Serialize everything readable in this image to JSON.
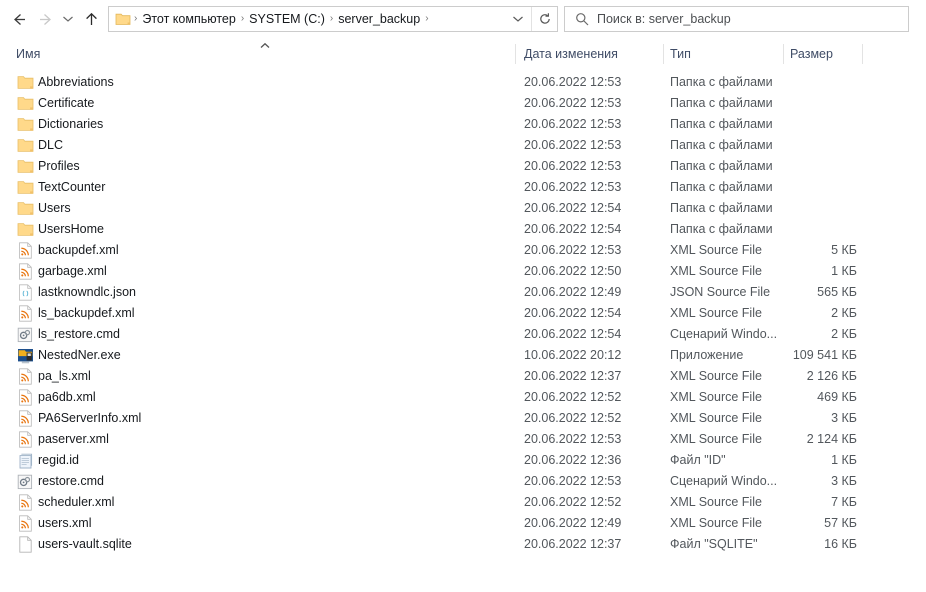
{
  "nav": {
    "back": "back-arrow",
    "forward": "forward-arrow",
    "recent": "recent-locations-chevron",
    "up": "up-arrow"
  },
  "address": {
    "crumbs": [
      "Этот компьютер",
      "SYSTEM (C:)",
      "server_backup"
    ],
    "separator": "›",
    "dropdown_icon": "chevron-down-icon",
    "refresh_icon": "refresh-icon"
  },
  "search": {
    "placeholder": "Поиск в: server_backup",
    "icon": "search-icon"
  },
  "columns": {
    "name": "Имя",
    "date": "Дата изменения",
    "type": "Тип",
    "size": "Размер",
    "sort_indicator": "ascending-chevron"
  },
  "rows": [
    {
      "name": "Abbreviations",
      "date": "20.06.2022 12:53",
      "type": "Папка с файлами",
      "size": "",
      "icon": "folder-icon"
    },
    {
      "name": "Certificate",
      "date": "20.06.2022 12:53",
      "type": "Папка с файлами",
      "size": "",
      "icon": "folder-icon"
    },
    {
      "name": "Dictionaries",
      "date": "20.06.2022 12:53",
      "type": "Папка с файлами",
      "size": "",
      "icon": "folder-icon"
    },
    {
      "name": "DLC",
      "date": "20.06.2022 12:53",
      "type": "Папка с файлами",
      "size": "",
      "icon": "folder-icon"
    },
    {
      "name": "Profiles",
      "date": "20.06.2022 12:53",
      "type": "Папка с файлами",
      "size": "",
      "icon": "folder-icon"
    },
    {
      "name": "TextCounter",
      "date": "20.06.2022 12:53",
      "type": "Папка с файлами",
      "size": "",
      "icon": "folder-icon"
    },
    {
      "name": "Users",
      "date": "20.06.2022 12:54",
      "type": "Папка с файлами",
      "size": "",
      "icon": "folder-icon"
    },
    {
      "name": "UsersHome",
      "date": "20.06.2022 12:54",
      "type": "Папка с файлами",
      "size": "",
      "icon": "folder-icon"
    },
    {
      "name": "backupdef.xml",
      "date": "20.06.2022 12:53",
      "type": "XML Source File",
      "size": "5 КБ",
      "icon": "xml-file-icon"
    },
    {
      "name": "garbage.xml",
      "date": "20.06.2022 12:50",
      "type": "XML Source File",
      "size": "1 КБ",
      "icon": "xml-file-icon"
    },
    {
      "name": "lastknowndlc.json",
      "date": "20.06.2022 12:49",
      "type": "JSON Source File",
      "size": "565 КБ",
      "icon": "json-file-icon"
    },
    {
      "name": "ls_backupdef.xml",
      "date": "20.06.2022 12:54",
      "type": "XML Source File",
      "size": "2 КБ",
      "icon": "xml-file-icon"
    },
    {
      "name": "ls_restore.cmd",
      "date": "20.06.2022 12:54",
      "type": "Сценарий Windo...",
      "size": "2 КБ",
      "icon": "cmd-script-icon"
    },
    {
      "name": "NestedNer.exe",
      "date": "10.06.2022 20:12",
      "type": "Приложение",
      "size": "109 541 КБ",
      "icon": "application-icon"
    },
    {
      "name": "pa_ls.xml",
      "date": "20.06.2022 12:37",
      "type": "XML Source File",
      "size": "2 126 КБ",
      "icon": "xml-file-icon"
    },
    {
      "name": "pa6db.xml",
      "date": "20.06.2022 12:52",
      "type": "XML Source File",
      "size": "469 КБ",
      "icon": "xml-file-icon"
    },
    {
      "name": "PA6ServerInfo.xml",
      "date": "20.06.2022 12:52",
      "type": "XML Source File",
      "size": "3 КБ",
      "icon": "xml-file-icon"
    },
    {
      "name": "paserver.xml",
      "date": "20.06.2022 12:53",
      "type": "XML Source File",
      "size": "2 124 КБ",
      "icon": "xml-file-icon"
    },
    {
      "name": "regid.id",
      "date": "20.06.2022 12:36",
      "type": "Файл \"ID\"",
      "size": "1 КБ",
      "icon": "notepad-file-icon"
    },
    {
      "name": "restore.cmd",
      "date": "20.06.2022 12:53",
      "type": "Сценарий Windo...",
      "size": "3 КБ",
      "icon": "cmd-script-icon"
    },
    {
      "name": "scheduler.xml",
      "date": "20.06.2022 12:52",
      "type": "XML Source File",
      "size": "7 КБ",
      "icon": "xml-file-icon"
    },
    {
      "name": "users.xml",
      "date": "20.06.2022 12:49",
      "type": "XML Source File",
      "size": "57 КБ",
      "icon": "xml-file-icon"
    },
    {
      "name": "users-vault.sqlite",
      "date": "20.06.2022 12:37",
      "type": "Файл \"SQLITE\"",
      "size": "16 КБ",
      "icon": "blank-file-icon"
    }
  ],
  "colors": {
    "folder": "#ffd98a",
    "header_text": "#3f4c66",
    "name_text": "#16191d",
    "meta_text": "#52575c",
    "border": "#cccccc"
  }
}
